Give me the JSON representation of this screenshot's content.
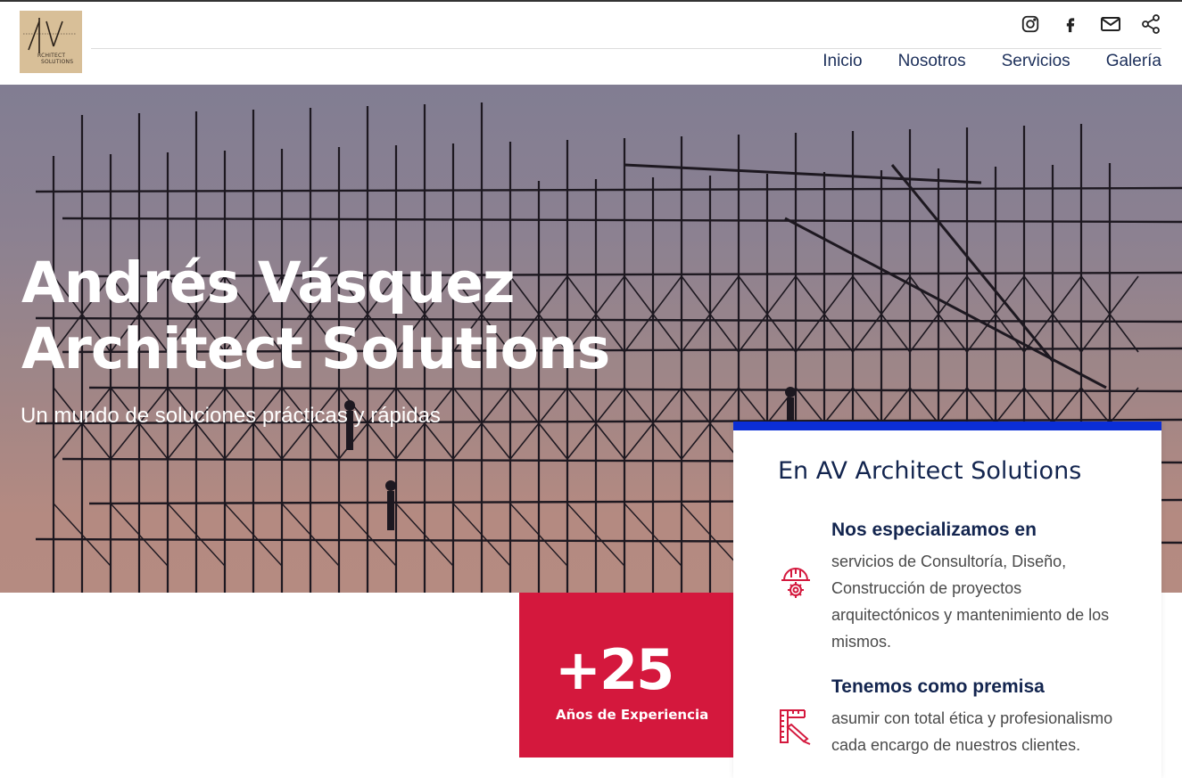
{
  "brand": {
    "logo_mark": "AV",
    "logo_text_line1": "RCHITECT",
    "logo_text_line2": "SOLUTIONS"
  },
  "social": {
    "icons": [
      "instagram-icon",
      "facebook-icon",
      "mail-icon",
      "share-icon"
    ]
  },
  "nav": {
    "items": [
      "Inicio",
      "Nosotros",
      "Servicios",
      "Galería"
    ]
  },
  "hero": {
    "title_line1": "Andrés Vásquez",
    "title_line2": "Architect Solutions",
    "subtitle": "Un mundo de soluciones prácticas y rápidas"
  },
  "experience": {
    "value": "+25",
    "label": "Años de Experiencia"
  },
  "about_card": {
    "title": "En AV Architect Solutions",
    "features": [
      {
        "icon": "hardhat-gear-icon",
        "title": "Nos especializamos en",
        "text": "servicios de Consultoría, Diseño, Construcción de proyectos arquitectónicos y mantenimiento de los mismos."
      },
      {
        "icon": "ruler-pencil-icon",
        "title": "Tenemos como premisa",
        "text": "asumir con total ética y profesionalismo cada encargo de nuestros clientes."
      }
    ]
  },
  "colors": {
    "accent_red": "#d4183d",
    "accent_blue": "#0b2ed6",
    "navy_text": "#13254f"
  }
}
